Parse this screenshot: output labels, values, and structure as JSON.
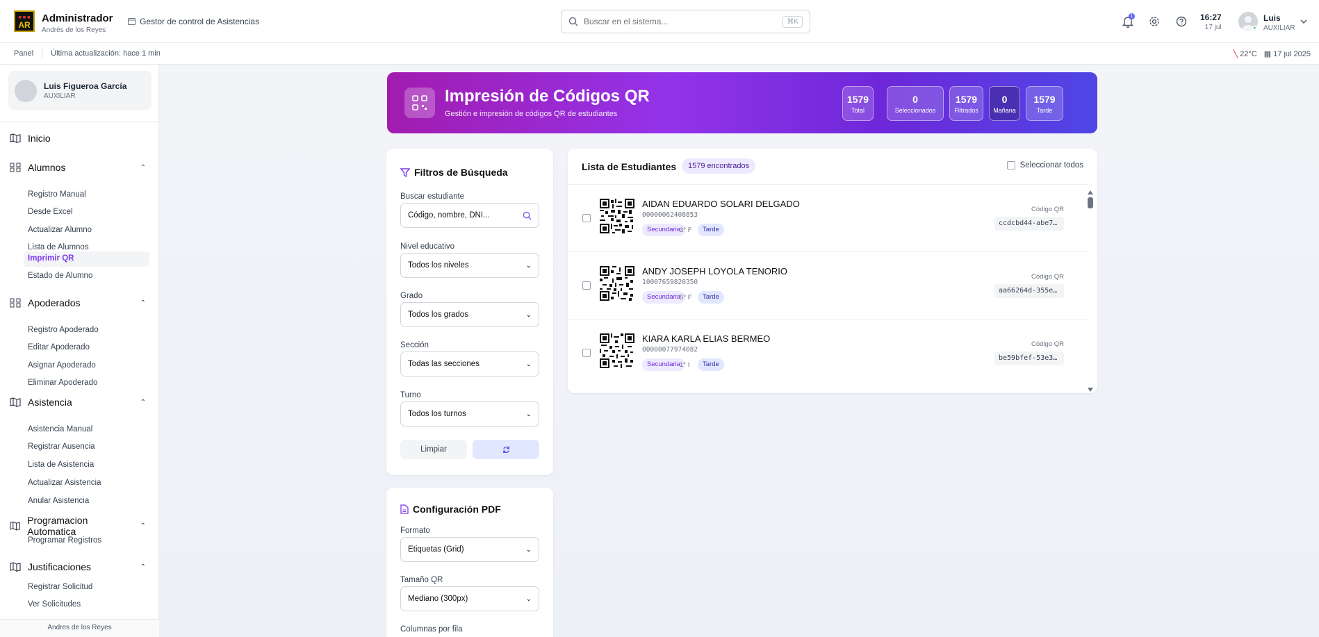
{
  "topbar": {
    "logo_text": "AR",
    "brand_title": "Administrador",
    "brand_subtitle": "Andrés de los Reyes",
    "app_name": "Gestor de control de Asistencias",
    "search_placeholder": "Buscar en el sistema...",
    "search_shortcut": "⌘K",
    "notification_count": "1",
    "time": "16:27",
    "date": "17 jul",
    "user_name": "Luis",
    "user_role": "AUXILIAR"
  },
  "subbar": {
    "panel": "Panel",
    "last_update": "Última actualización: hace 1 min",
    "temperature": "22°C",
    "full_date": "17 jul 2025"
  },
  "sidebar": {
    "profile_name": "Luis Figueroa García",
    "profile_role": "AUXILIAR",
    "inicio": "Inicio",
    "alumnos": "Alumnos",
    "alumnos_items": [
      "Registro Manual",
      "Desde Excel",
      "Actualizar Alumno",
      "Lista de Alumnos",
      "Imprimir QR",
      "Estado de Alumno"
    ],
    "apoderados": "Apoderados",
    "apoderados_items": [
      "Registro Apoderado",
      "Editar Apoderado",
      "Asignar Apoderado",
      "Eliminar Apoderado"
    ],
    "asistencia": "Asistencia",
    "asistencia_items": [
      "Asistencia Manual",
      "Registrar Ausencia",
      "Lista de Asistencia",
      "Actualizar Asistencia",
      "Anular Asistencia"
    ],
    "programacion": "Programacion Automatica",
    "programacion_items": [
      "Programar Registros"
    ],
    "justificaciones": "Justificaciones",
    "justificaciones_items": [
      "Registrar Solicitud",
      "Ver Solicitudes"
    ],
    "footer": "Andres de los Reyes"
  },
  "hero": {
    "title": "Impresión de Códigos QR",
    "subtitle": "Gestión e impresión de códigos QR de estudiantes",
    "stats": [
      {
        "value": "1579",
        "label": "Total"
      },
      {
        "value": "0",
        "label": "Seleccionados"
      },
      {
        "value": "1579",
        "label": "Filtrados"
      },
      {
        "value": "0",
        "label": "Mañana"
      },
      {
        "value": "1579",
        "label": "Tarde"
      }
    ]
  },
  "filters": {
    "title": "Filtros de Búsqueda",
    "search_label": "Buscar estudiante",
    "search_placeholder": "Código, nombre, DNI...",
    "nivel_label": "Nivel educativo",
    "nivel_value": "Todos los niveles",
    "grado_label": "Grado",
    "grado_value": "Todos los grados",
    "seccion_label": "Sección",
    "seccion_value": "Todas las secciones",
    "turno_label": "Turno",
    "turno_value": "Todos los turnos",
    "clear_button": "Limpiar"
  },
  "pdf": {
    "title": "Configuración PDF",
    "formato_label": "Formato",
    "formato_value": "Etiquetas (Grid)",
    "tamano_label": "Tamaño QR",
    "tamano_value": "Mediano (300px)",
    "columnas_label": "Columnas por fila"
  },
  "list": {
    "title": "Lista de Estudiantes",
    "count": "1579 encontrados",
    "select_all": "Seleccionar todos",
    "qr_label": "Código QR",
    "students": [
      {
        "name": "AIDAN EDUARDO SOLARI DELGADO",
        "code": "00000062408853",
        "level": "Secundaria",
        "grade": "3° F",
        "shift": "Tarde",
        "qr": "ccdcbd44-abe7…"
      },
      {
        "name": "ANDY JOSEPH LOYOLA TENORIO",
        "code": "10007659820350",
        "level": "Secundaria",
        "grade": "5° F",
        "shift": "Tarde",
        "qr": "aa66264d-355e…"
      },
      {
        "name": "KIARA KARLA ELIAS BERMEO",
        "code": "00000077974082",
        "level": "Secundaria",
        "grade": "1° I",
        "shift": "Tarde",
        "qr": "be59bfef-53e3…"
      }
    ]
  },
  "colors": {
    "hero_start": "#a21caf",
    "hero_end": "#4f46e5",
    "accent": "#7c3aed"
  }
}
